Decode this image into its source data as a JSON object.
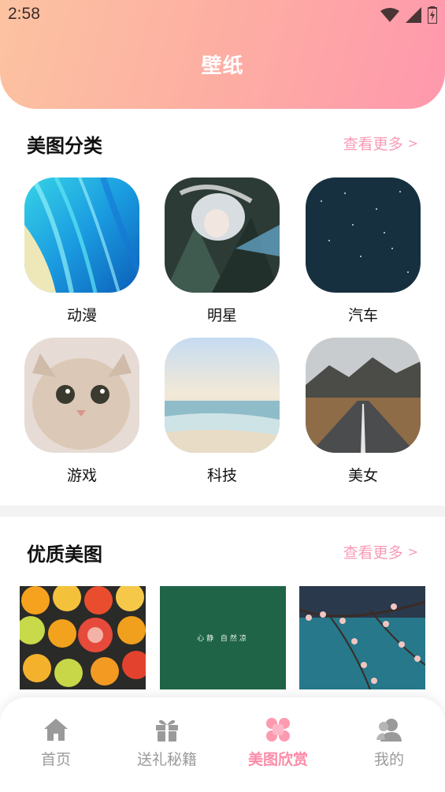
{
  "status_bar": {
    "time": "2:58",
    "icons": [
      "wifi-icon",
      "signal-icon",
      "battery-icon"
    ]
  },
  "header": {
    "title": "壁纸"
  },
  "categories_section": {
    "title": "美图分类",
    "more": "查看更多",
    "more_arrow": ">",
    "items": [
      {
        "label": "动漫"
      },
      {
        "label": "明星"
      },
      {
        "label": "汽车"
      },
      {
        "label": "游戏"
      },
      {
        "label": "科技"
      },
      {
        "label": "美女"
      }
    ]
  },
  "quality_section": {
    "title": "优质美图",
    "more": "查看更多",
    "more_arrow": ">",
    "photos": [
      {
        "caption": ""
      },
      {
        "caption": "心静 自然凉"
      },
      {
        "caption": ""
      }
    ]
  },
  "tabbar": {
    "tabs": [
      {
        "label": "首页",
        "icon": "home-icon",
        "active": false
      },
      {
        "label": "送礼秘籍",
        "icon": "gift-icon",
        "active": false
      },
      {
        "label": "美图欣赏",
        "icon": "clover-icon",
        "active": true
      },
      {
        "label": "我的",
        "icon": "user-icon",
        "active": false
      }
    ]
  },
  "colors": {
    "accent": "#fd8aa7",
    "more_link": "#f79bb6",
    "header_start": "#fcc3a1",
    "header_end": "#ff98ad"
  }
}
